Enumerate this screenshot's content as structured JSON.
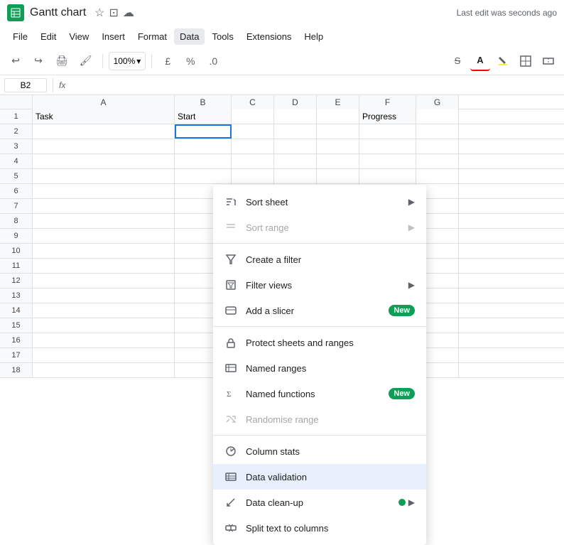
{
  "titleBar": {
    "docTitle": "Gantt chart",
    "lastEdit": "Last edit was seconds ago"
  },
  "menuBar": {
    "items": [
      "File",
      "Edit",
      "View",
      "Insert",
      "Format",
      "Data",
      "Tools",
      "Extensions",
      "Help"
    ]
  },
  "toolbar": {
    "zoom": "100%",
    "zoomSymbol": "▾"
  },
  "formulaBar": {
    "cellRef": "B2",
    "fxLabel": "fx"
  },
  "sheet": {
    "columns": [
      "A",
      "B",
      "C",
      "D",
      "E",
      "F",
      "G"
    ],
    "rows": [
      {
        "num": 1,
        "cells": [
          "Task",
          "Start",
          "",
          "",
          "",
          "Progress",
          ""
        ]
      },
      {
        "num": 2,
        "cells": [
          "",
          "",
          "",
          "",
          "",
          "",
          ""
        ]
      },
      {
        "num": 3,
        "cells": [
          "",
          "",
          "",
          "",
          "",
          "",
          ""
        ]
      },
      {
        "num": 4,
        "cells": [
          "",
          "",
          "",
          "",
          "",
          "",
          ""
        ]
      },
      {
        "num": 5,
        "cells": [
          "",
          "",
          "",
          "",
          "",
          "",
          ""
        ]
      },
      {
        "num": 6,
        "cells": [
          "",
          "",
          "",
          "",
          "",
          "",
          ""
        ]
      },
      {
        "num": 7,
        "cells": [
          "",
          "",
          "",
          "",
          "",
          "",
          ""
        ]
      },
      {
        "num": 8,
        "cells": [
          "",
          "",
          "",
          "",
          "",
          "",
          ""
        ]
      },
      {
        "num": 9,
        "cells": [
          "",
          "",
          "",
          "",
          "",
          "",
          ""
        ]
      },
      {
        "num": 10,
        "cells": [
          "",
          "",
          "",
          "",
          "",
          "",
          ""
        ]
      },
      {
        "num": 11,
        "cells": [
          "",
          "",
          "",
          "",
          "",
          "",
          ""
        ]
      },
      {
        "num": 12,
        "cells": [
          "",
          "",
          "",
          "",
          "",
          "",
          ""
        ]
      },
      {
        "num": 13,
        "cells": [
          "",
          "",
          "",
          "",
          "",
          "",
          ""
        ]
      },
      {
        "num": 14,
        "cells": [
          "",
          "",
          "",
          "",
          "",
          "",
          ""
        ]
      },
      {
        "num": 15,
        "cells": [
          "",
          "",
          "",
          "",
          "",
          "",
          ""
        ]
      },
      {
        "num": 16,
        "cells": [
          "",
          "",
          "",
          "",
          "",
          "",
          ""
        ]
      },
      {
        "num": 17,
        "cells": [
          "",
          "",
          "",
          "",
          "",
          "",
          ""
        ]
      },
      {
        "num": 18,
        "cells": [
          "",
          "",
          "",
          "",
          "",
          "",
          ""
        ]
      }
    ]
  },
  "dataMenu": {
    "items": [
      {
        "id": "sort-sheet",
        "label": "Sort sheet",
        "hasArrow": true,
        "icon": "sort",
        "disabled": false,
        "active": false
      },
      {
        "id": "sort-range",
        "label": "Sort range",
        "hasArrow": true,
        "icon": "sort-range",
        "disabled": true,
        "active": false
      },
      {
        "id": "divider1"
      },
      {
        "id": "create-filter",
        "label": "Create a filter",
        "hasArrow": false,
        "icon": "filter",
        "disabled": false,
        "active": false
      },
      {
        "id": "filter-views",
        "label": "Filter views",
        "hasArrow": true,
        "icon": "filter-views",
        "disabled": false,
        "active": false
      },
      {
        "id": "add-slicer",
        "label": "Add a slicer",
        "hasArrow": false,
        "icon": "slicer",
        "disabled": false,
        "active": false,
        "badge": "New"
      },
      {
        "id": "divider2"
      },
      {
        "id": "protect-sheets",
        "label": "Protect sheets and ranges",
        "hasArrow": false,
        "icon": "protect",
        "disabled": false,
        "active": false
      },
      {
        "id": "named-ranges",
        "label": "Named ranges",
        "hasArrow": false,
        "icon": "named-ranges",
        "disabled": false,
        "active": false
      },
      {
        "id": "named-functions",
        "label": "Named functions",
        "hasArrow": false,
        "icon": "named-functions",
        "disabled": false,
        "active": false,
        "badge": "New"
      },
      {
        "id": "randomise-range",
        "label": "Randomise range",
        "hasArrow": false,
        "icon": "randomise",
        "disabled": true,
        "active": false
      },
      {
        "id": "divider3"
      },
      {
        "id": "column-stats",
        "label": "Column stats",
        "hasArrow": false,
        "icon": "column-stats",
        "disabled": false,
        "active": false
      },
      {
        "id": "data-validation",
        "label": "Data validation",
        "hasArrow": false,
        "icon": "data-validation",
        "disabled": false,
        "active": true
      },
      {
        "id": "data-cleanup",
        "label": "Data clean-up",
        "hasArrow": true,
        "icon": "data-cleanup",
        "disabled": false,
        "active": false,
        "dot": true
      },
      {
        "id": "split-text",
        "label": "Split text to columns",
        "hasArrow": false,
        "icon": "split-text",
        "disabled": false,
        "active": false
      }
    ]
  }
}
